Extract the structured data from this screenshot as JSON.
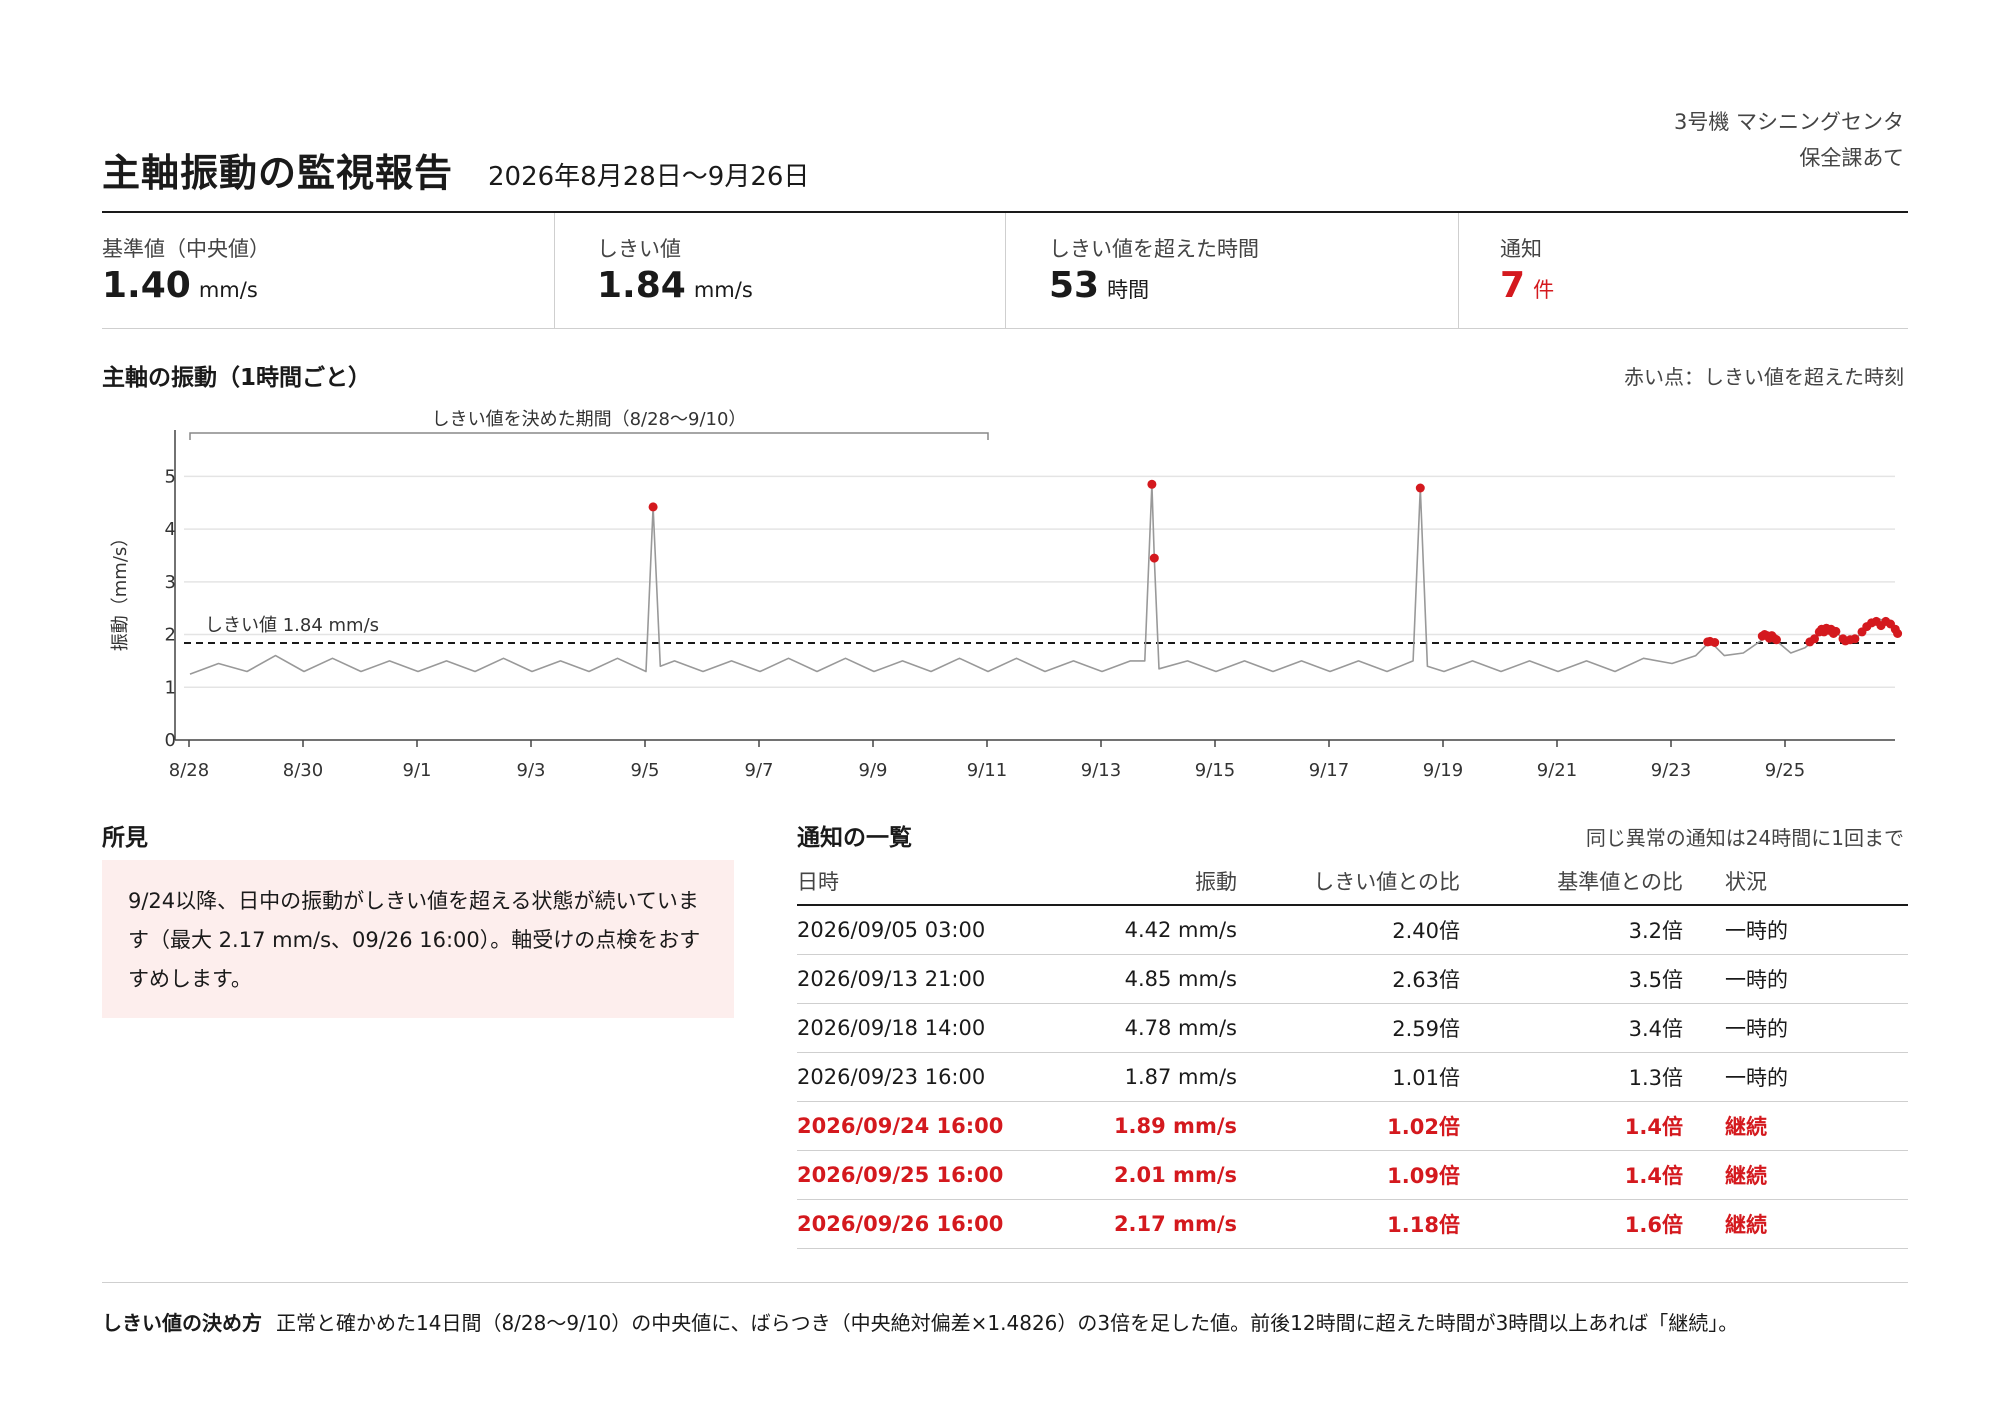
{
  "header": {
    "title": "主軸振動の監視報告",
    "period": "2026年8月28日〜9月26日",
    "machine": "3号機 マシニングセンタ",
    "recipient": "保全課あて"
  },
  "kpis": [
    {
      "label": "基準値（中央値）",
      "value": "1.40",
      "unit": "mm/s"
    },
    {
      "label": "しきい値",
      "value": "1.84",
      "unit": "mm/s"
    },
    {
      "label": "しきい値を超えた時間",
      "value": "53",
      "unit": "時間"
    },
    {
      "label": "通知",
      "value": "7",
      "unit": "件"
    }
  ],
  "chart_section": {
    "title": "主軸の振動（1時間ごと）",
    "note": "赤い点：しきい値を超えた時刻"
  },
  "chart_data": {
    "type": "line",
    "ylabel": "振動（mm/s）",
    "ylim": [
      0,
      5.5
    ],
    "yticks": [
      0,
      1,
      2,
      3,
      4,
      5
    ],
    "x_start": "2026-08-28T00:00",
    "x_end": "2026-09-27T00:00",
    "x_tick_labels": [
      "8/28",
      "8/30",
      "9/1",
      "9/3",
      "9/5",
      "9/7",
      "9/9",
      "9/11",
      "9/13",
      "9/15",
      "9/17",
      "9/19",
      "9/21",
      "9/23",
      "9/25"
    ],
    "threshold": 1.84,
    "threshold_label": "しきい値 1.84 mm/s",
    "baseline_period_label": "しきい値を決めた期間（8/28〜9/10）",
    "baseline_period": [
      "2026-08-28T00:00",
      "2026-09-11T00:00"
    ],
    "series": [
      {
        "values": [
          {
            "t": "2026-08-28T00:00",
            "y": 1.25
          },
          {
            "t": "2026-08-28T12:00",
            "y": 1.45
          },
          {
            "t": "2026-08-29T00:00",
            "y": 1.3
          },
          {
            "t": "2026-08-29T12:00",
            "y": 1.6
          },
          {
            "t": "2026-08-30T00:00",
            "y": 1.3
          },
          {
            "t": "2026-08-30T12:00",
            "y": 1.55
          },
          {
            "t": "2026-08-31T00:00",
            "y": 1.3
          },
          {
            "t": "2026-08-31T12:00",
            "y": 1.5
          },
          {
            "t": "2026-09-01T00:00",
            "y": 1.3
          },
          {
            "t": "2026-09-01T12:00",
            "y": 1.5
          },
          {
            "t": "2026-09-02T00:00",
            "y": 1.3
          },
          {
            "t": "2026-09-02T12:00",
            "y": 1.55
          },
          {
            "t": "2026-09-03T00:00",
            "y": 1.3
          },
          {
            "t": "2026-09-03T12:00",
            "y": 1.5
          },
          {
            "t": "2026-09-04T00:00",
            "y": 1.3
          },
          {
            "t": "2026-09-04T12:00",
            "y": 1.55
          },
          {
            "t": "2026-09-05T00:00",
            "y": 1.3
          },
          {
            "t": "2026-09-05T03:00",
            "y": 4.42
          },
          {
            "t": "2026-09-05T06:00",
            "y": 1.4
          },
          {
            "t": "2026-09-05T12:00",
            "y": 1.5
          },
          {
            "t": "2026-09-06T00:00",
            "y": 1.3
          },
          {
            "t": "2026-09-06T12:00",
            "y": 1.5
          },
          {
            "t": "2026-09-07T00:00",
            "y": 1.3
          },
          {
            "t": "2026-09-07T12:00",
            "y": 1.55
          },
          {
            "t": "2026-09-08T00:00",
            "y": 1.3
          },
          {
            "t": "2026-09-08T12:00",
            "y": 1.55
          },
          {
            "t": "2026-09-09T00:00",
            "y": 1.3
          },
          {
            "t": "2026-09-09T12:00",
            "y": 1.5
          },
          {
            "t": "2026-09-10T00:00",
            "y": 1.3
          },
          {
            "t": "2026-09-10T12:00",
            "y": 1.55
          },
          {
            "t": "2026-09-11T00:00",
            "y": 1.3
          },
          {
            "t": "2026-09-11T12:00",
            "y": 1.55
          },
          {
            "t": "2026-09-12T00:00",
            "y": 1.3
          },
          {
            "t": "2026-09-12T12:00",
            "y": 1.5
          },
          {
            "t": "2026-09-13T00:00",
            "y": 1.3
          },
          {
            "t": "2026-09-13T12:00",
            "y": 1.5
          },
          {
            "t": "2026-09-13T18:00",
            "y": 1.5
          },
          {
            "t": "2026-09-13T21:00",
            "y": 4.85
          },
          {
            "t": "2026-09-13T22:00",
            "y": 3.45
          },
          {
            "t": "2026-09-14T00:00",
            "y": 1.35
          },
          {
            "t": "2026-09-14T12:00",
            "y": 1.5
          },
          {
            "t": "2026-09-15T00:00",
            "y": 1.3
          },
          {
            "t": "2026-09-15T12:00",
            "y": 1.5
          },
          {
            "t": "2026-09-16T00:00",
            "y": 1.3
          },
          {
            "t": "2026-09-16T12:00",
            "y": 1.5
          },
          {
            "t": "2026-09-17T00:00",
            "y": 1.3
          },
          {
            "t": "2026-09-17T12:00",
            "y": 1.5
          },
          {
            "t": "2026-09-18T00:00",
            "y": 1.3
          },
          {
            "t": "2026-09-18T11:00",
            "y": 1.5
          },
          {
            "t": "2026-09-18T14:00",
            "y": 4.78
          },
          {
            "t": "2026-09-18T17:00",
            "y": 1.4
          },
          {
            "t": "2026-09-19T00:00",
            "y": 1.3
          },
          {
            "t": "2026-09-19T12:00",
            "y": 1.5
          },
          {
            "t": "2026-09-20T00:00",
            "y": 1.3
          },
          {
            "t": "2026-09-20T12:00",
            "y": 1.5
          },
          {
            "t": "2026-09-21T00:00",
            "y": 1.3
          },
          {
            "t": "2026-09-21T12:00",
            "y": 1.5
          },
          {
            "t": "2026-09-22T00:00",
            "y": 1.3
          },
          {
            "t": "2026-09-22T12:00",
            "y": 1.55
          },
          {
            "t": "2026-09-23T00:00",
            "y": 1.45
          },
          {
            "t": "2026-09-23T10:00",
            "y": 1.6
          },
          {
            "t": "2026-09-23T16:00",
            "y": 1.87
          },
          {
            "t": "2026-09-23T22:00",
            "y": 1.6
          },
          {
            "t": "2026-09-24T06:00",
            "y": 1.65
          },
          {
            "t": "2026-09-24T14:00",
            "y": 1.9
          },
          {
            "t": "2026-09-24T16:00",
            "y": 2.0
          },
          {
            "t": "2026-09-24T18:00",
            "y": 1.95
          },
          {
            "t": "2026-09-24T20:00",
            "y": 1.88
          },
          {
            "t": "2026-09-25T02:00",
            "y": 1.65
          },
          {
            "t": "2026-09-25T08:00",
            "y": 1.75
          },
          {
            "t": "2026-09-25T12:00",
            "y": 1.9
          },
          {
            "t": "2026-09-25T15:00",
            "y": 2.05
          },
          {
            "t": "2026-09-25T18:00",
            "y": 2.1
          },
          {
            "t": "2026-09-25T21:00",
            "y": 2.05
          },
          {
            "t": "2026-09-26T00:00",
            "y": 1.92
          },
          {
            "t": "2026-09-26T03:00",
            "y": 1.88
          },
          {
            "t": "2026-09-26T06:00",
            "y": 1.95
          },
          {
            "t": "2026-09-26T09:00",
            "y": 2.1
          },
          {
            "t": "2026-09-26T12:00",
            "y": 2.25
          },
          {
            "t": "2026-09-26T15:00",
            "y": 2.3
          },
          {
            "t": "2026-09-26T18:00",
            "y": 2.25
          },
          {
            "t": "2026-09-26T21:00",
            "y": 2.2
          },
          {
            "t": "2026-09-26T23:00",
            "y": 2.05
          }
        ]
      }
    ],
    "exceed_points": [
      {
        "t": "2026-09-05T03:00",
        "y": 4.42
      },
      {
        "t": "2026-09-13T21:00",
        "y": 4.85
      },
      {
        "t": "2026-09-13T22:00",
        "y": 3.45
      },
      {
        "t": "2026-09-18T14:00",
        "y": 4.78
      },
      {
        "t": "2026-09-23T15:00",
        "y": 1.86
      },
      {
        "t": "2026-09-23T16:00",
        "y": 1.87
      },
      {
        "t": "2026-09-23T18:00",
        "y": 1.85
      },
      {
        "t": "2026-09-24T14:00",
        "y": 1.97
      },
      {
        "t": "2026-09-24T15:00",
        "y": 2.0
      },
      {
        "t": "2026-09-24T16:00",
        "y": 1.98
      },
      {
        "t": "2026-09-24T17:00",
        "y": 1.93
      },
      {
        "t": "2026-09-24T18:00",
        "y": 1.98
      },
      {
        "t": "2026-09-24T19:00",
        "y": 1.93
      },
      {
        "t": "2026-09-24T20:00",
        "y": 1.9
      },
      {
        "t": "2026-09-25T10:00",
        "y": 1.86
      },
      {
        "t": "2026-09-25T12:00",
        "y": 1.92
      },
      {
        "t": "2026-09-25T14:00",
        "y": 2.05
      },
      {
        "t": "2026-09-25T15:00",
        "y": 2.1
      },
      {
        "t": "2026-09-25T16:00",
        "y": 2.05
      },
      {
        "t": "2026-09-25T17:00",
        "y": 2.12
      },
      {
        "t": "2026-09-25T18:00",
        "y": 2.08
      },
      {
        "t": "2026-09-25T19:00",
        "y": 2.1
      },
      {
        "t": "2026-09-25T20:00",
        "y": 2.02
      },
      {
        "t": "2026-09-25T21:00",
        "y": 2.06
      },
      {
        "t": "2026-09-26T00:00",
        "y": 1.92
      },
      {
        "t": "2026-09-26T01:00",
        "y": 1.88
      },
      {
        "t": "2026-09-26T03:00",
        "y": 1.9
      },
      {
        "t": "2026-09-26T05:00",
        "y": 1.92
      },
      {
        "t": "2026-09-26T08:00",
        "y": 2.05
      },
      {
        "t": "2026-09-26T10:00",
        "y": 2.15
      },
      {
        "t": "2026-09-26T12:00",
        "y": 2.22
      },
      {
        "t": "2026-09-26T14:00",
        "y": 2.25
      },
      {
        "t": "2026-09-26T16:00",
        "y": 2.17
      },
      {
        "t": "2026-09-26T18:00",
        "y": 2.25
      },
      {
        "t": "2026-09-26T20:00",
        "y": 2.2
      },
      {
        "t": "2026-09-26T22:00",
        "y": 2.1
      },
      {
        "t": "2026-09-26T23:00",
        "y": 2.02
      }
    ],
    "colors": {
      "line": "#999999",
      "exceed": "#d4191e",
      "threshold": "#1a1a1a",
      "grid": "#e4e4e4"
    }
  },
  "findings": {
    "title": "所見",
    "text": "9/24以降、日中の振動がしきい値を超える状態が続いています（最大 2.17 mm/s、09/26 16:00）。軸受けの点検をおすすめします。"
  },
  "alerts": {
    "title": "通知の一覧",
    "note": "同じ異常の通知は24時間に1回まで",
    "columns": [
      "日時",
      "振動",
      "しきい値との比",
      "基準値との比",
      "状況"
    ],
    "rows": [
      {
        "datetime": "2026/09/05 03:00",
        "vibration": "4.42 mm/s",
        "threshold_ratio": "2.40倍",
        "baseline_ratio": "3.2倍",
        "status": "一時的"
      },
      {
        "datetime": "2026/09/13 21:00",
        "vibration": "4.85 mm/s",
        "threshold_ratio": "2.63倍",
        "baseline_ratio": "3.5倍",
        "status": "一時的"
      },
      {
        "datetime": "2026/09/18 14:00",
        "vibration": "4.78 mm/s",
        "threshold_ratio": "2.59倍",
        "baseline_ratio": "3.4倍",
        "status": "一時的"
      },
      {
        "datetime": "2026/09/23 16:00",
        "vibration": "1.87 mm/s",
        "threshold_ratio": "1.01倍",
        "baseline_ratio": "1.3倍",
        "status": "一時的"
      },
      {
        "datetime": "2026/09/24 16:00",
        "vibration": "1.89 mm/s",
        "threshold_ratio": "1.02倍",
        "baseline_ratio": "1.4倍",
        "status": "継続"
      },
      {
        "datetime": "2026/09/25 16:00",
        "vibration": "2.01 mm/s",
        "threshold_ratio": "1.09倍",
        "baseline_ratio": "1.4倍",
        "status": "継続"
      },
      {
        "datetime": "2026/09/26 16:00",
        "vibration": "2.17 mm/s",
        "threshold_ratio": "1.18倍",
        "baseline_ratio": "1.6倍",
        "status": "継続"
      }
    ]
  },
  "footnote": {
    "label": "しきい値の決め方",
    "text": "正常と確かめた14日間（8/28〜9/10）の中央値に、ばらつき（中央絶対偏差×1.4826）の3倍を足した値。前後12時間に超えた時間が3時間以上あれば「継続」。"
  }
}
